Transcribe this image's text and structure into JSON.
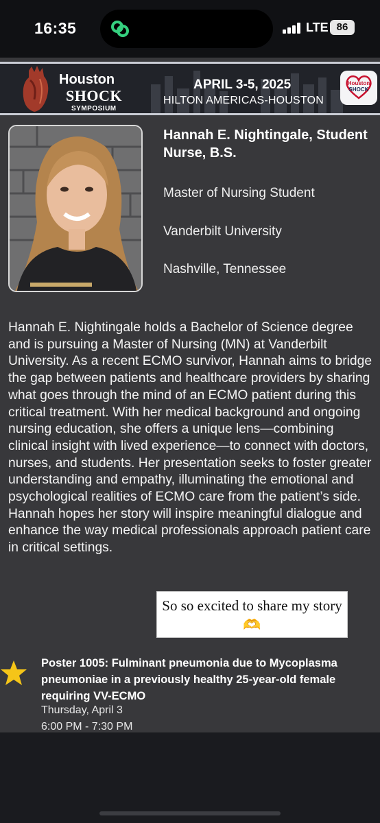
{
  "status_bar": {
    "time": "16:35",
    "network": "LTE",
    "battery": "86",
    "icons": [
      "app-activity-icon",
      "signal-bars-icon",
      "battery-icon"
    ]
  },
  "banner": {
    "brand_line1": "Houston",
    "brand_line2": "SHOCK",
    "brand_line3": "SYMPOSIUM",
    "dates": "APRIL 3-5, 2025",
    "venue": "HILTON AMERICAS-HOUSTON",
    "badge_top": "Houston",
    "badge_bottom": "SHOCK"
  },
  "speaker": {
    "name": "Hannah E. Nightingale, Student Nurse, B.S.",
    "program": "Master of Nursing Student",
    "university": "Vanderbilt University",
    "location": "Nashville, Tennessee"
  },
  "bio": "Hannah E. Nightingale holds a Bachelor of Science degree and is pursuing a Master of Nursing (MN) at Vanderbilt University. As a recent ECMO survivor, Hannah aims to bridge the gap between patients and healthcare providers by sharing what goes through the mind of an ECMO patient during this critical treatment. With her medical background and ongoing nursing education, she offers a unique lens—combining clinical insight with lived experience—to connect with doctors, nurses, and students. Her presentation seeks to foster greater understanding and empathy, illuminating the emotional and psychological realities of ECMO care from the patient’s side. Hannah hopes her story will inspire meaningful dialogue and enhance the way medical professionals approach patient care in critical settings.",
  "sticker": {
    "text": "So so excited to share my story 🫶"
  },
  "poster": {
    "title": "Poster 1005: Fulminant pneumonia due to Mycoplasma pneumoniae in a previously healthy 25-year-old female requiring VV-ECMO",
    "date": "Thursday, April 3",
    "time": "6:00 PM - 7:30 PM"
  },
  "colors": {
    "card_background": "#38383b",
    "banner_background": "#212329",
    "star": "#f5c518",
    "badge_red": "#c8102e"
  }
}
